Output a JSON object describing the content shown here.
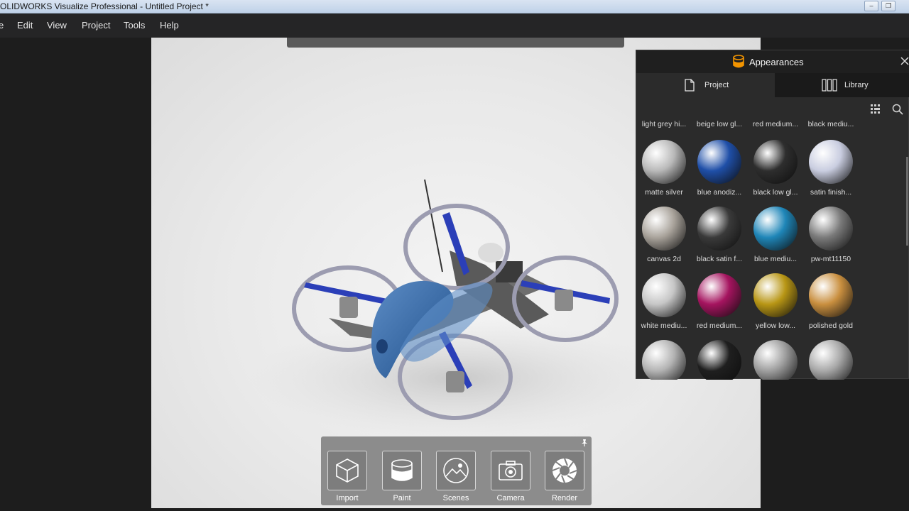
{
  "window": {
    "title": "OLIDWORKS Visualize Professional - Untitled Project *"
  },
  "menu": {
    "items": [
      "e",
      "Edit",
      "View",
      "Project",
      "Tools",
      "Help"
    ]
  },
  "toolbar": {
    "items": [
      {
        "label": "Import",
        "icon": "cube-icon"
      },
      {
        "label": "Paint",
        "icon": "paint-can-icon"
      },
      {
        "label": "Scenes",
        "icon": "landscape-icon"
      },
      {
        "label": "Camera",
        "icon": "camera-icon"
      },
      {
        "label": "Render",
        "icon": "aperture-icon"
      }
    ]
  },
  "appearances": {
    "title": "Appearances",
    "tabs": [
      {
        "label": "Project",
        "icon": "document-icon",
        "active": true
      },
      {
        "label": "Library",
        "icon": "library-icon",
        "active": false
      }
    ],
    "top_row_labels": [
      "light grey hi...",
      "beige low gl...",
      "red medium...",
      "black mediu..."
    ],
    "materials": [
      {
        "label": "matte silver",
        "color": "#b9b9b9"
      },
      {
        "label": "blue anodiz...",
        "color": "#1f4fa8"
      },
      {
        "label": "black low gl...",
        "color": "#2e2e2e"
      },
      {
        "label": "satin finish...",
        "color": "#c9cde0"
      },
      {
        "label": "canvas 2d",
        "color": "#a9a39b"
      },
      {
        "label": "black satin f...",
        "color": "#3a3a3a"
      },
      {
        "label": "blue mediu...",
        "color": "#1f86b8"
      },
      {
        "label": "pw-mt11150",
        "color": "#7a7a7a"
      },
      {
        "label": "white mediu...",
        "color": "#c6c6c6"
      },
      {
        "label": "red medium...",
        "color": "#a5145f"
      },
      {
        "label": "yellow low...",
        "color": "#b89615"
      },
      {
        "label": "polished gold",
        "color": "#c98f3f"
      },
      {
        "label": "",
        "color": "#b3b3b3"
      },
      {
        "label": "",
        "color": "#1f1f1f"
      },
      {
        "label": "",
        "color": "#9e9e9e"
      },
      {
        "label": "",
        "color": "#a8a8a8"
      }
    ]
  },
  "colors": {
    "accent": "#f29400",
    "panel_bg": "#2b2b2b"
  }
}
